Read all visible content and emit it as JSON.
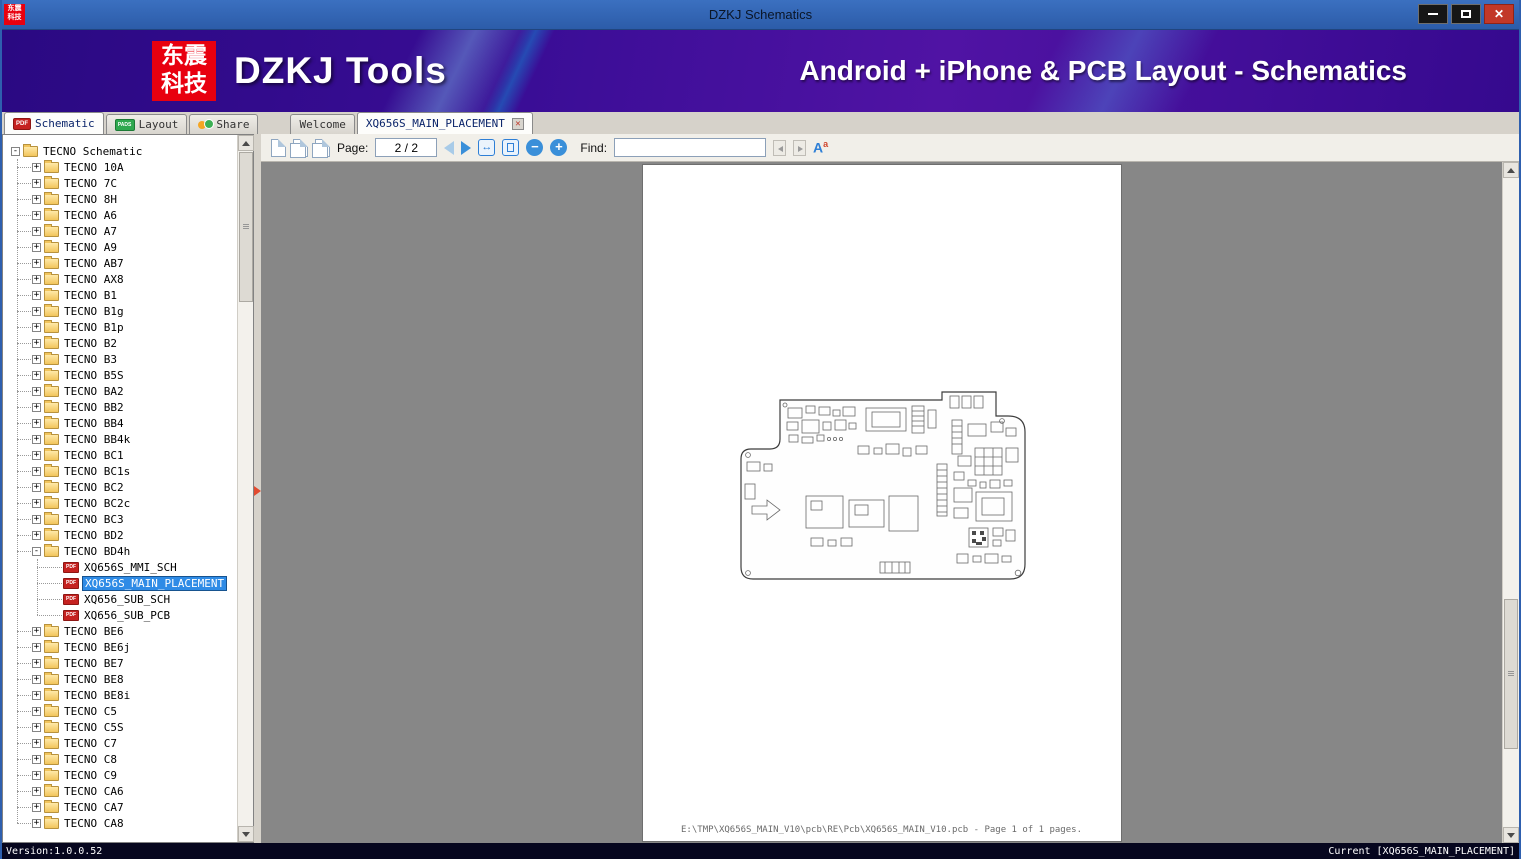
{
  "window": {
    "title": "DZKJ Schematics"
  },
  "banner": {
    "logo_top": "东震",
    "logo_bottom": "科技",
    "title": "DZKJ Tools",
    "subtitle": "Android + iPhone & PCB Layout - Schematics"
  },
  "main_tabs": [
    {
      "label": "Schematic"
    },
    {
      "label": "Layout"
    },
    {
      "label": "Share"
    }
  ],
  "doc_tabs": [
    {
      "label": "Welcome"
    },
    {
      "label": "XQ656S_MAIN_PLACEMENT"
    }
  ],
  "toolbar": {
    "page_label": "Page:",
    "page_value": "2 / 2",
    "find_label": "Find:",
    "find_value": ""
  },
  "icons": {
    "pdf_label": "PDF",
    "pads_label": "PADS",
    "expand": "+",
    "collapse": "-",
    "font_big": "A",
    "font_small": "a"
  },
  "tree": {
    "root_label": "TECNO Schematic",
    "items": [
      {
        "label": "TECNO 10A"
      },
      {
        "label": "TECNO 7C"
      },
      {
        "label": "TECNO 8H"
      },
      {
        "label": "TECNO A6"
      },
      {
        "label": "TECNO A7"
      },
      {
        "label": "TECNO A9"
      },
      {
        "label": "TECNO AB7"
      },
      {
        "label": "TECNO AX8"
      },
      {
        "label": "TECNO B1"
      },
      {
        "label": "TECNO B1g"
      },
      {
        "label": "TECNO B1p"
      },
      {
        "label": "TECNO B2"
      },
      {
        "label": "TECNO B3"
      },
      {
        "label": "TECNO B5S"
      },
      {
        "label": "TECNO BA2"
      },
      {
        "label": "TECNO BB2"
      },
      {
        "label": "TECNO BB4"
      },
      {
        "label": "TECNO BB4k"
      },
      {
        "label": "TECNO BC1"
      },
      {
        "label": "TECNO BC1s"
      },
      {
        "label": "TECNO BC2"
      },
      {
        "label": "TECNO BC2c"
      },
      {
        "label": "TECNO BC3"
      },
      {
        "label": "TECNO BD2"
      },
      {
        "label": "TECNO BD4h",
        "expanded": true,
        "children": [
          {
            "label": "XQ656S_MMI_SCH",
            "type": "pdf"
          },
          {
            "label": "XQ656S_MAIN_PLACEMENT",
            "type": "pdf",
            "selected": true
          },
          {
            "label": "XQ656_SUB_SCH",
            "type": "pdf"
          },
          {
            "label": "XQ656_SUB_PCB",
            "type": "pdf"
          }
        ]
      },
      {
        "label": "TECNO BE6"
      },
      {
        "label": "TECNO BE6j"
      },
      {
        "label": "TECNO BE7"
      },
      {
        "label": "TECNO BE8"
      },
      {
        "label": "TECNO BE8i"
      },
      {
        "label": "TECNO C5"
      },
      {
        "label": "TECNO C5S"
      },
      {
        "label": "TECNO C7"
      },
      {
        "label": "TECNO C8"
      },
      {
        "label": "TECNO C9"
      },
      {
        "label": "TECNO CA6"
      },
      {
        "label": "TECNO CA7"
      },
      {
        "label": "TECNO CA8"
      }
    ]
  },
  "document": {
    "footer": "E:\\TMP\\XQ656S_MAIN_V10\\pcb\\RE\\Pcb\\XQ656S_MAIN_V10.pcb - Page 1 of 1 pages."
  },
  "status": {
    "version": "Version:1.0.0.52",
    "current": "Current [XQ656S_MAIN_PLACEMENT]"
  },
  "colors": {
    "titlebar_blue": "#3B70C0",
    "banner_purple": "#3A0D96",
    "logo_red": "#E8000F",
    "selection_blue": "#2E8BE6",
    "close_red": "#C23828",
    "toolbar_icon_blue": "#3A8FD9"
  }
}
